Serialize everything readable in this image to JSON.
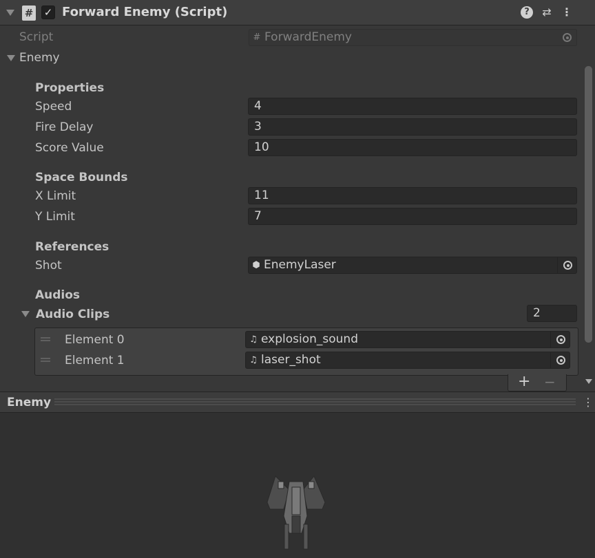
{
  "component": {
    "title": "Forward Enemy (Script)",
    "enabled": true
  },
  "script": {
    "label": "Script",
    "value": "ForwardEnemy"
  },
  "enemy_foldout": {
    "label": "Enemy"
  },
  "sections": {
    "properties": "Properties",
    "space_bounds": "Space Bounds",
    "references": "References",
    "audios": "Audios"
  },
  "fields": {
    "speed": {
      "label": "Speed",
      "value": "4"
    },
    "fire_delay": {
      "label": "Fire Delay",
      "value": "3"
    },
    "score_value": {
      "label": "Score Value",
      "value": "10"
    },
    "x_limit": {
      "label": "X Limit",
      "value": "11"
    },
    "y_limit": {
      "label": "Y Limit",
      "value": "7"
    },
    "shot": {
      "label": "Shot",
      "value": "EnemyLaser"
    }
  },
  "audio_clips": {
    "label": "Audio Clips",
    "size": "2",
    "elements": [
      {
        "label": "Element 0",
        "value": "explosion_sound"
      },
      {
        "label": "Element 1",
        "value": "laser_shot"
      }
    ],
    "add_label": "+",
    "remove_label": "−"
  },
  "preview": {
    "title": "Enemy"
  },
  "icons": {
    "help": "?",
    "presets": "⇄",
    "more": "⋮",
    "script": "#",
    "check": "✓",
    "audio": "♫",
    "prefab": "⬢"
  }
}
